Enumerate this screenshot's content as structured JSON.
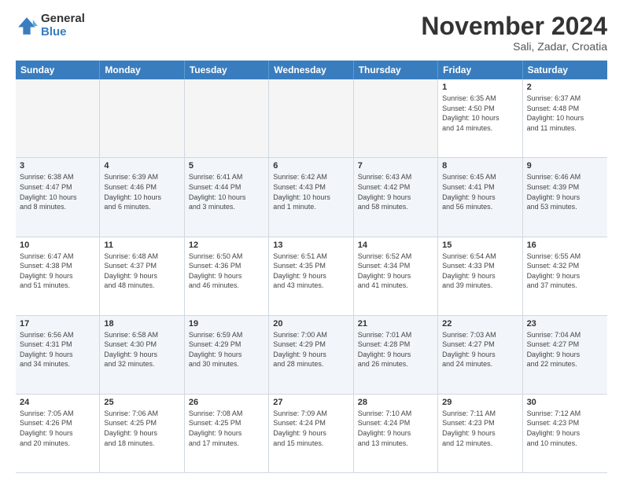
{
  "logo": {
    "general": "General",
    "blue": "Blue"
  },
  "title": "November 2024",
  "location": "Sali, Zadar, Croatia",
  "header_days": [
    "Sunday",
    "Monday",
    "Tuesday",
    "Wednesday",
    "Thursday",
    "Friday",
    "Saturday"
  ],
  "weeks": [
    [
      {
        "day": "",
        "info": ""
      },
      {
        "day": "",
        "info": ""
      },
      {
        "day": "",
        "info": ""
      },
      {
        "day": "",
        "info": ""
      },
      {
        "day": "",
        "info": ""
      },
      {
        "day": "1",
        "info": "Sunrise: 6:35 AM\nSunset: 4:50 PM\nDaylight: 10 hours\nand 14 minutes."
      },
      {
        "day": "2",
        "info": "Sunrise: 6:37 AM\nSunset: 4:48 PM\nDaylight: 10 hours\nand 11 minutes."
      }
    ],
    [
      {
        "day": "3",
        "info": "Sunrise: 6:38 AM\nSunset: 4:47 PM\nDaylight: 10 hours\nand 8 minutes."
      },
      {
        "day": "4",
        "info": "Sunrise: 6:39 AM\nSunset: 4:46 PM\nDaylight: 10 hours\nand 6 minutes."
      },
      {
        "day": "5",
        "info": "Sunrise: 6:41 AM\nSunset: 4:44 PM\nDaylight: 10 hours\nand 3 minutes."
      },
      {
        "day": "6",
        "info": "Sunrise: 6:42 AM\nSunset: 4:43 PM\nDaylight: 10 hours\nand 1 minute."
      },
      {
        "day": "7",
        "info": "Sunrise: 6:43 AM\nSunset: 4:42 PM\nDaylight: 9 hours\nand 58 minutes."
      },
      {
        "day": "8",
        "info": "Sunrise: 6:45 AM\nSunset: 4:41 PM\nDaylight: 9 hours\nand 56 minutes."
      },
      {
        "day": "9",
        "info": "Sunrise: 6:46 AM\nSunset: 4:39 PM\nDaylight: 9 hours\nand 53 minutes."
      }
    ],
    [
      {
        "day": "10",
        "info": "Sunrise: 6:47 AM\nSunset: 4:38 PM\nDaylight: 9 hours\nand 51 minutes."
      },
      {
        "day": "11",
        "info": "Sunrise: 6:48 AM\nSunset: 4:37 PM\nDaylight: 9 hours\nand 48 minutes."
      },
      {
        "day": "12",
        "info": "Sunrise: 6:50 AM\nSunset: 4:36 PM\nDaylight: 9 hours\nand 46 minutes."
      },
      {
        "day": "13",
        "info": "Sunrise: 6:51 AM\nSunset: 4:35 PM\nDaylight: 9 hours\nand 43 minutes."
      },
      {
        "day": "14",
        "info": "Sunrise: 6:52 AM\nSunset: 4:34 PM\nDaylight: 9 hours\nand 41 minutes."
      },
      {
        "day": "15",
        "info": "Sunrise: 6:54 AM\nSunset: 4:33 PM\nDaylight: 9 hours\nand 39 minutes."
      },
      {
        "day": "16",
        "info": "Sunrise: 6:55 AM\nSunset: 4:32 PM\nDaylight: 9 hours\nand 37 minutes."
      }
    ],
    [
      {
        "day": "17",
        "info": "Sunrise: 6:56 AM\nSunset: 4:31 PM\nDaylight: 9 hours\nand 34 minutes."
      },
      {
        "day": "18",
        "info": "Sunrise: 6:58 AM\nSunset: 4:30 PM\nDaylight: 9 hours\nand 32 minutes."
      },
      {
        "day": "19",
        "info": "Sunrise: 6:59 AM\nSunset: 4:29 PM\nDaylight: 9 hours\nand 30 minutes."
      },
      {
        "day": "20",
        "info": "Sunrise: 7:00 AM\nSunset: 4:29 PM\nDaylight: 9 hours\nand 28 minutes."
      },
      {
        "day": "21",
        "info": "Sunrise: 7:01 AM\nSunset: 4:28 PM\nDaylight: 9 hours\nand 26 minutes."
      },
      {
        "day": "22",
        "info": "Sunrise: 7:03 AM\nSunset: 4:27 PM\nDaylight: 9 hours\nand 24 minutes."
      },
      {
        "day": "23",
        "info": "Sunrise: 7:04 AM\nSunset: 4:27 PM\nDaylight: 9 hours\nand 22 minutes."
      }
    ],
    [
      {
        "day": "24",
        "info": "Sunrise: 7:05 AM\nSunset: 4:26 PM\nDaylight: 9 hours\nand 20 minutes."
      },
      {
        "day": "25",
        "info": "Sunrise: 7:06 AM\nSunset: 4:25 PM\nDaylight: 9 hours\nand 18 minutes."
      },
      {
        "day": "26",
        "info": "Sunrise: 7:08 AM\nSunset: 4:25 PM\nDaylight: 9 hours\nand 17 minutes."
      },
      {
        "day": "27",
        "info": "Sunrise: 7:09 AM\nSunset: 4:24 PM\nDaylight: 9 hours\nand 15 minutes."
      },
      {
        "day": "28",
        "info": "Sunrise: 7:10 AM\nSunset: 4:24 PM\nDaylight: 9 hours\nand 13 minutes."
      },
      {
        "day": "29",
        "info": "Sunrise: 7:11 AM\nSunset: 4:23 PM\nDaylight: 9 hours\nand 12 minutes."
      },
      {
        "day": "30",
        "info": "Sunrise: 7:12 AM\nSunset: 4:23 PM\nDaylight: 9 hours\nand 10 minutes."
      }
    ]
  ]
}
